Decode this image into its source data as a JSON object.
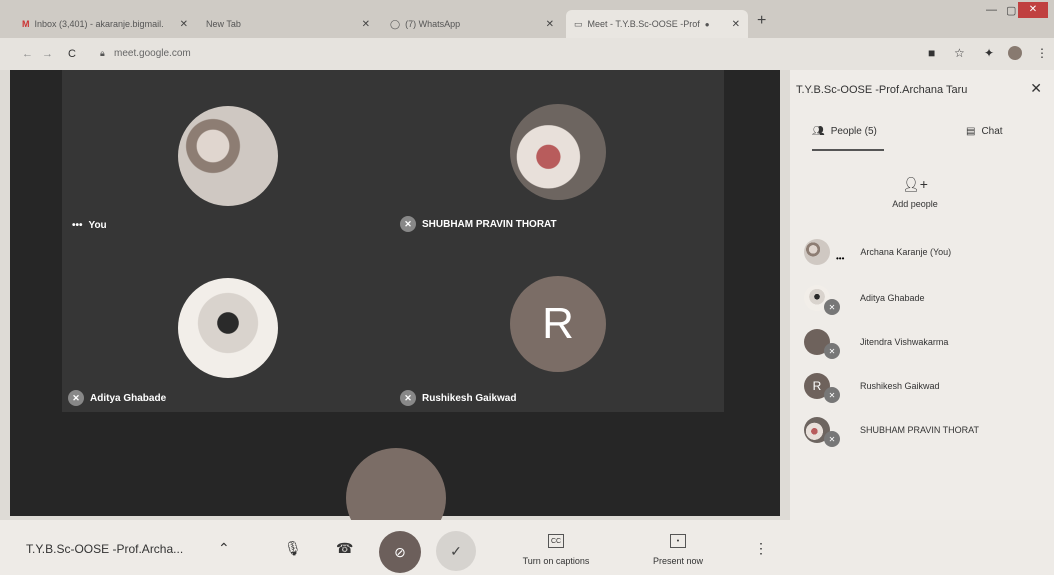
{
  "browser": {
    "tabs": [
      {
        "label": "Inbox (3,401) - akaranje.bigmail.",
        "icon": "gmail-icon"
      },
      {
        "label": "New Tab",
        "icon": ""
      },
      {
        "label": "(7) WhatsApp",
        "icon": "whatsapp-icon"
      },
      {
        "label": "Meet - T.Y.B.Sc-OOSE -Prof",
        "icon": "meet-icon"
      }
    ],
    "new_tab": "+",
    "url": "meet.google.com"
  },
  "tiles": [
    {
      "name": "You",
      "prefix": "•••"
    },
    {
      "name": "SHUBHAM PRAVIN THORAT"
    },
    {
      "name": "Aditya Ghabade"
    },
    {
      "name": "Rushikesh Gaikwad",
      "avatar_letter": "R"
    }
  ],
  "panel": {
    "title": "T.Y.B.Sc-OOSE -Prof.Archana Taru",
    "close": "✕",
    "people_tab": "People (5)",
    "chat_tab": "Chat",
    "add_people": "Add people",
    "people": [
      {
        "name": "Archana Karanje (You)",
        "dots": "•••"
      },
      {
        "name": "Aditya Ghabade"
      },
      {
        "name": "Jitendra Vishwakarma"
      },
      {
        "name": "Rushikesh Gaikwad",
        "letter": "R"
      },
      {
        "name": "SHUBHAM PRAVIN THORAT"
      }
    ]
  },
  "bottom": {
    "meeting_title": "T.Y.B.Sc-OOSE -Prof.Archa...",
    "captions_label": "Turn on captions",
    "captions_icon": "CC",
    "present_label": "Present now"
  }
}
